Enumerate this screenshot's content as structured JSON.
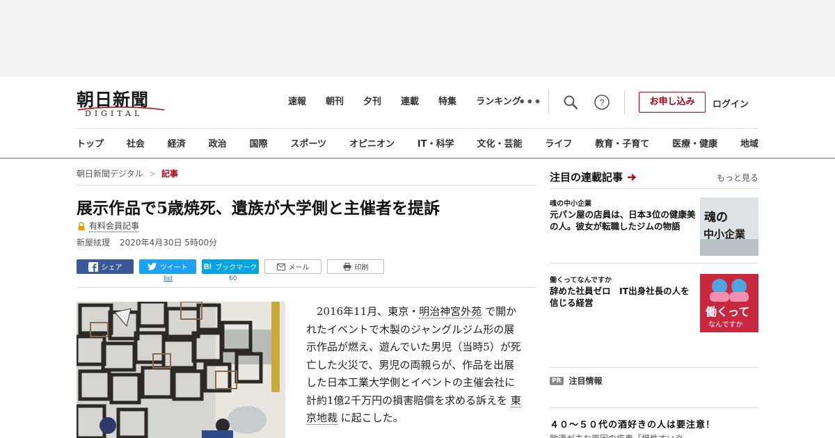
{
  "brand": {
    "name": "朝日新聞",
    "sub": "DIGITAL"
  },
  "topnav": [
    "速報",
    "朝刊",
    "夕刊",
    "連載",
    "特集",
    "ランキング"
  ],
  "header_actions": {
    "more": "•••",
    "signup": "お申し込み",
    "login": "ログイン"
  },
  "categories": [
    "トップ",
    "社会",
    "経済",
    "政治",
    "国際",
    "スポーツ",
    "オピニオン",
    "IT・科学",
    "文化・芸能",
    "ライフ",
    "教育・子育て",
    "医療・健康",
    "地域"
  ],
  "breadcrumb": {
    "home": "朝日新聞デジタル",
    "sep": ">",
    "current": "記事"
  },
  "article": {
    "title": "展示作品で5歳焼死、遺族が大学側と主催者を提訴",
    "paid_label": "有料会員記事",
    "author": "新屋絃理",
    "date": "2020年4月30日 5時00分",
    "body_parts": {
      "p1": "2016年11月、東京・",
      "link1": "明治神宮外苑",
      "p2": "で開かれたイベントで木製のジャングルジム形の展示作品が燃え、遊んでいた男児（当時5）が死亡した火災で、男児の両親らが、作品を出展した日本工業大学側とイベントの主催会社に計約1億2千万円の損害賠償を求める訴えを",
      "link2": "東京地裁",
      "p3": "に起こした。"
    }
  },
  "share": {
    "facebook": "シェア",
    "twitter": "ツイート",
    "hatena": "ブックマーク",
    "mail": "メール",
    "print": "印刷",
    "twitter_count": "list",
    "hatena_count": "60"
  },
  "sidebar": {
    "title": "注目の連載記事",
    "more": "もっと見る",
    "cards": [
      {
        "series": "魂の中小企業",
        "title": "元パン屋の店員は、日本3位の健康美の人。彼女が転職したジムの物語",
        "thumb_text": "魂の\n中小企業"
      },
      {
        "series": "働くってなんですか",
        "title": "辞めた社員ゼロ　IT出身社長の人を信じる経営",
        "thumb_text": "働くって\nなんですか"
      }
    ],
    "pr_badge": "PR",
    "pr_label": "注目情報",
    "pr_headline": "４０～５０代の酒好きの人は要注意！",
    "pr_sub": "飲酒が主な原因の疾患「慢性すい炎"
  },
  "colors": {
    "brand_red": "#b10010",
    "facebook": "#3b5998",
    "twitter": "#1da1f2",
    "hatena": "#00a4de"
  }
}
